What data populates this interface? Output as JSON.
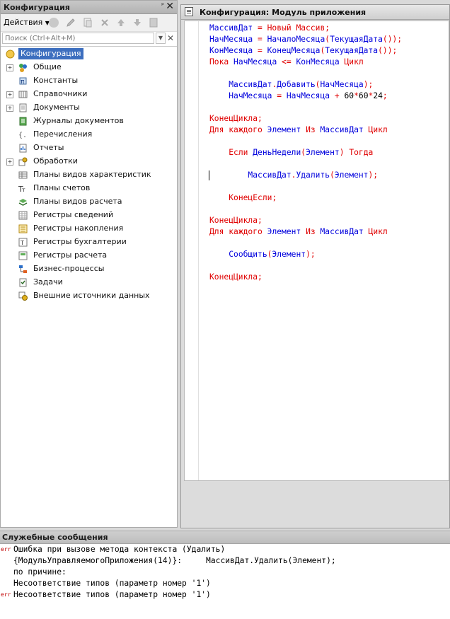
{
  "config_panel": {
    "title": "Конфигурация",
    "pin_icon": "pin-icon",
    "close_label": "✕",
    "actions_label": "Действия",
    "search_placeholder": "Поиск (Ctrl+Alt+M)",
    "tree": [
      {
        "label": "Конфигурация",
        "icon": "configuration-icon",
        "expandable": false,
        "root": true
      },
      {
        "label": "Общие",
        "icon": "common-icon",
        "expandable": true
      },
      {
        "label": "Константы",
        "icon": "constants-icon",
        "expandable": false
      },
      {
        "label": "Справочники",
        "icon": "catalogs-icon",
        "expandable": true
      },
      {
        "label": "Документы",
        "icon": "documents-icon",
        "expandable": true
      },
      {
        "label": "Журналы документов",
        "icon": "document-journals-icon",
        "expandable": false
      },
      {
        "label": "Перечисления",
        "icon": "enums-icon",
        "expandable": false
      },
      {
        "label": "Отчеты",
        "icon": "reports-icon",
        "expandable": false
      },
      {
        "label": "Обработки",
        "icon": "data-processors-icon",
        "expandable": true
      },
      {
        "label": "Планы видов характеристик",
        "icon": "characteristic-types-icon",
        "expandable": false
      },
      {
        "label": "Планы счетов",
        "icon": "chart-of-accounts-icon",
        "expandable": false
      },
      {
        "label": "Планы видов расчета",
        "icon": "calculation-types-icon",
        "expandable": false
      },
      {
        "label": "Регистры сведений",
        "icon": "information-registers-icon",
        "expandable": false
      },
      {
        "label": "Регистры накопления",
        "icon": "accumulation-registers-icon",
        "expandable": false
      },
      {
        "label": "Регистры бухгалтерии",
        "icon": "accounting-registers-icon",
        "expandable": false
      },
      {
        "label": "Регистры расчета",
        "icon": "calculation-registers-icon",
        "expandable": false
      },
      {
        "label": "Бизнес-процессы",
        "icon": "business-processes-icon",
        "expandable": false
      },
      {
        "label": "Задачи",
        "icon": "tasks-icon",
        "expandable": false
      },
      {
        "label": "Внешние источники данных",
        "icon": "external-data-sources-icon",
        "expandable": false
      }
    ]
  },
  "editor": {
    "title": "Конфигурация: Модуль приложения",
    "lines": [
      [
        {
          "t": "МассивДат",
          "c": "id"
        },
        {
          "t": " = ",
          "c": "op"
        },
        {
          "t": "Новый",
          "c": "kw"
        },
        {
          "t": " ",
          "c": "nm"
        },
        {
          "t": "Массив",
          "c": "kw"
        },
        {
          "t": ";",
          "c": "op"
        }
      ],
      [
        {
          "t": "НачМесяца",
          "c": "id"
        },
        {
          "t": " = ",
          "c": "op"
        },
        {
          "t": "НачалоМесяца",
          "c": "id"
        },
        {
          "t": "(",
          "c": "op"
        },
        {
          "t": "ТекущаяДата",
          "c": "id"
        },
        {
          "t": "());",
          "c": "op"
        }
      ],
      [
        {
          "t": "КонМесяца",
          "c": "id"
        },
        {
          "t": " = ",
          "c": "op"
        },
        {
          "t": "КонецМесяца",
          "c": "id"
        },
        {
          "t": "(",
          "c": "op"
        },
        {
          "t": "ТекущаяДата",
          "c": "id"
        },
        {
          "t": "());",
          "c": "op"
        }
      ],
      [
        {
          "t": "Пока",
          "c": "kw"
        },
        {
          "t": " ",
          "c": "nm"
        },
        {
          "t": "НачМесяца",
          "c": "id"
        },
        {
          "t": " <= ",
          "c": "op"
        },
        {
          "t": "КонМесяца",
          "c": "id"
        },
        {
          "t": " ",
          "c": "nm"
        },
        {
          "t": "Цикл",
          "c": "kw"
        }
      ],
      [],
      [
        {
          "t": "    ",
          "c": "nm"
        },
        {
          "t": "МассивДат",
          "c": "id"
        },
        {
          "t": ".",
          "c": "op"
        },
        {
          "t": "Добавить",
          "c": "id"
        },
        {
          "t": "(",
          "c": "op"
        },
        {
          "t": "НачМесяца",
          "c": "id"
        },
        {
          "t": ");",
          "c": "op"
        }
      ],
      [
        {
          "t": "    ",
          "c": "nm"
        },
        {
          "t": "НачМесяца",
          "c": "id"
        },
        {
          "t": " = ",
          "c": "op"
        },
        {
          "t": "НачМесяца",
          "c": "id"
        },
        {
          "t": " + ",
          "c": "op"
        },
        {
          "t": "60",
          "c": "nm"
        },
        {
          "t": "*",
          "c": "op"
        },
        {
          "t": "60",
          "c": "nm"
        },
        {
          "t": "*",
          "c": "op"
        },
        {
          "t": "24",
          "c": "nm"
        },
        {
          "t": ";",
          "c": "op"
        }
      ],
      [],
      [
        {
          "t": "КонецЦикла",
          "c": "kw"
        },
        {
          "t": ";",
          "c": "op"
        }
      ],
      [
        {
          "t": "Для",
          "c": "kw"
        },
        {
          "t": " ",
          "c": "nm"
        },
        {
          "t": "каждого",
          "c": "kw"
        },
        {
          "t": " ",
          "c": "nm"
        },
        {
          "t": "Элемент",
          "c": "id"
        },
        {
          "t": " ",
          "c": "nm"
        },
        {
          "t": "Из",
          "c": "kw"
        },
        {
          "t": " ",
          "c": "nm"
        },
        {
          "t": "МассивДат",
          "c": "id"
        },
        {
          "t": " ",
          "c": "nm"
        },
        {
          "t": "Цикл",
          "c": "kw"
        }
      ],
      [],
      [
        {
          "t": "    ",
          "c": "nm"
        },
        {
          "t": "Если",
          "c": "kw"
        },
        {
          "t": " ",
          "c": "nm"
        },
        {
          "t": "ДеньНедели",
          "c": "id"
        },
        {
          "t": "(",
          "c": "op"
        },
        {
          "t": "Элемент",
          "c": "id"
        },
        {
          "t": ")",
          "c": "op"
        },
        {
          "t": " ",
          "c": "nm"
        },
        {
          "t": "Тогда",
          "c": "kw"
        }
      ],
      [],
      [
        {
          "t": "        ",
          "c": "nm"
        },
        {
          "t": "МассивДат",
          "c": "id"
        },
        {
          "t": ".",
          "c": "op"
        },
        {
          "t": "Удалить",
          "c": "id"
        },
        {
          "t": "(",
          "c": "op"
        },
        {
          "t": "Элемент",
          "c": "id"
        },
        {
          "t": ");",
          "c": "op"
        }
      ],
      [],
      [
        {
          "t": "    ",
          "c": "nm"
        },
        {
          "t": "КонецЕсли",
          "c": "kw"
        },
        {
          "t": ";",
          "c": "op"
        }
      ],
      [],
      [
        {
          "t": "КонецЦикла",
          "c": "kw"
        },
        {
          "t": ";",
          "c": "op"
        }
      ],
      [
        {
          "t": "Для",
          "c": "kw"
        },
        {
          "t": " ",
          "c": "nm"
        },
        {
          "t": "каждого",
          "c": "kw"
        },
        {
          "t": " ",
          "c": "nm"
        },
        {
          "t": "Элемент",
          "c": "id"
        },
        {
          "t": " ",
          "c": "nm"
        },
        {
          "t": "Из",
          "c": "kw"
        },
        {
          "t": " ",
          "c": "nm"
        },
        {
          "t": "МассивДат",
          "c": "id"
        },
        {
          "t": " ",
          "c": "nm"
        },
        {
          "t": "Цикл",
          "c": "kw"
        }
      ],
      [],
      [
        {
          "t": "    ",
          "c": "nm"
        },
        {
          "t": "Сообщить",
          "c": "id"
        },
        {
          "t": "(",
          "c": "op"
        },
        {
          "t": "Элемент",
          "c": "id"
        },
        {
          "t": ");",
          "c": "op"
        }
      ],
      [],
      [
        {
          "t": "КонецЦикла",
          "c": "kw"
        },
        {
          "t": ";",
          "c": "op"
        }
      ]
    ],
    "caret_line": 13,
    "colors": {
      "keyword": "#e00000",
      "identifier": "#0000dd",
      "number": "#000000"
    }
  },
  "messages": {
    "title": "Служебные сообщения",
    "lines": [
      {
        "err": true,
        "text": "Ошибка при вызове метода контекста (Удалить)"
      },
      {
        "err": false,
        "text": "{МодульУправляемогоПриложения(14)}:     МассивДат.Удалить(Элемент);"
      },
      {
        "err": false,
        "text": "по причине:"
      },
      {
        "err": false,
        "text": "Несоответствие типов (параметр номер '1')"
      },
      {
        "err": true,
        "text": "Несоответствие типов (параметр номер '1')"
      }
    ],
    "err_tag": "err"
  }
}
